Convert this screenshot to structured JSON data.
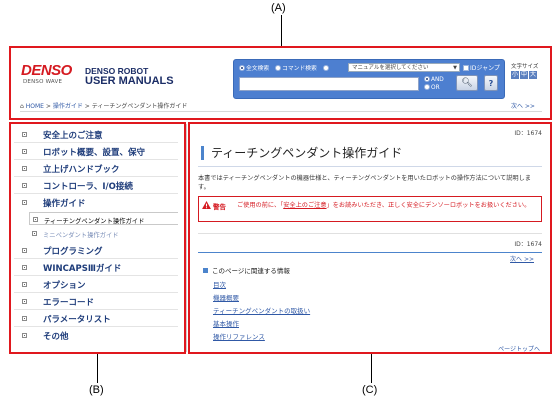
{
  "callouts": {
    "a": "(A)",
    "b": "(B)",
    "c": "(C)"
  },
  "header": {
    "logo_main": "DENSO",
    "logo_sub": "DENSO WAVE",
    "brand_line1": "DENSO ROBOT",
    "brand_line2": "USER MANUALS",
    "search": {
      "radio_fulltext": "全文検索",
      "radio_command": "コマンド検索",
      "manual_select_placeholder": "マニュアルを選択してください",
      "id_jump": "IDジャンプ",
      "and_label": "AND",
      "or_label": "OR",
      "help_label": "?"
    },
    "font_size_label": "文字サイズ",
    "font_size_buttons": [
      "小",
      "中",
      "大"
    ],
    "breadcrumb": {
      "home": "HOME",
      "sep": ">",
      "level1": "操作ガイド",
      "current": "ティーチングペンダント操作ガイド"
    },
    "next_link": "次へ >>"
  },
  "sidebar": {
    "items": [
      {
        "label": "安全上のご注意"
      },
      {
        "label": "ロボット概要、設置、保守"
      },
      {
        "label": "立上げハンドブック"
      },
      {
        "label": "コントローラ、I/O接続"
      },
      {
        "label": "操作ガイド"
      },
      {
        "label": "プログラミング"
      },
      {
        "label": "WINCAPSⅢガイド"
      },
      {
        "label": "オプション"
      },
      {
        "label": "エラーコード"
      },
      {
        "label": "パラメータリスト"
      },
      {
        "label": "その他"
      }
    ],
    "subitems": [
      {
        "label": "ティーチングペンダント操作ガイド",
        "state": "active"
      },
      {
        "label": "ミニペンダント操作ガイド",
        "state": "inactive"
      }
    ]
  },
  "content": {
    "id_top": "ID：1674",
    "title": "ティーチングペンダント操作ガイド",
    "intro": "本書ではティーチングペンダントの機器仕様と、ティーチングペンダントを用いたロボットの操作方法について説明します。",
    "warning_label": "警告",
    "warning_pre": "ご使用の前に、「",
    "warning_link": "安全上のご注意",
    "warning_post": "」をお読みいただき、正しく安全にデンソーロボットをお扱いください。",
    "id_mid": "ID：1674",
    "next_link": "次へ >>",
    "related_title": "このページに関連する情報",
    "related_links": [
      "目次",
      "機器概要",
      "ティーチングペンダントの取扱い",
      "基本操作",
      "操作リファレンス"
    ],
    "page_top": "ページトップへ"
  }
}
